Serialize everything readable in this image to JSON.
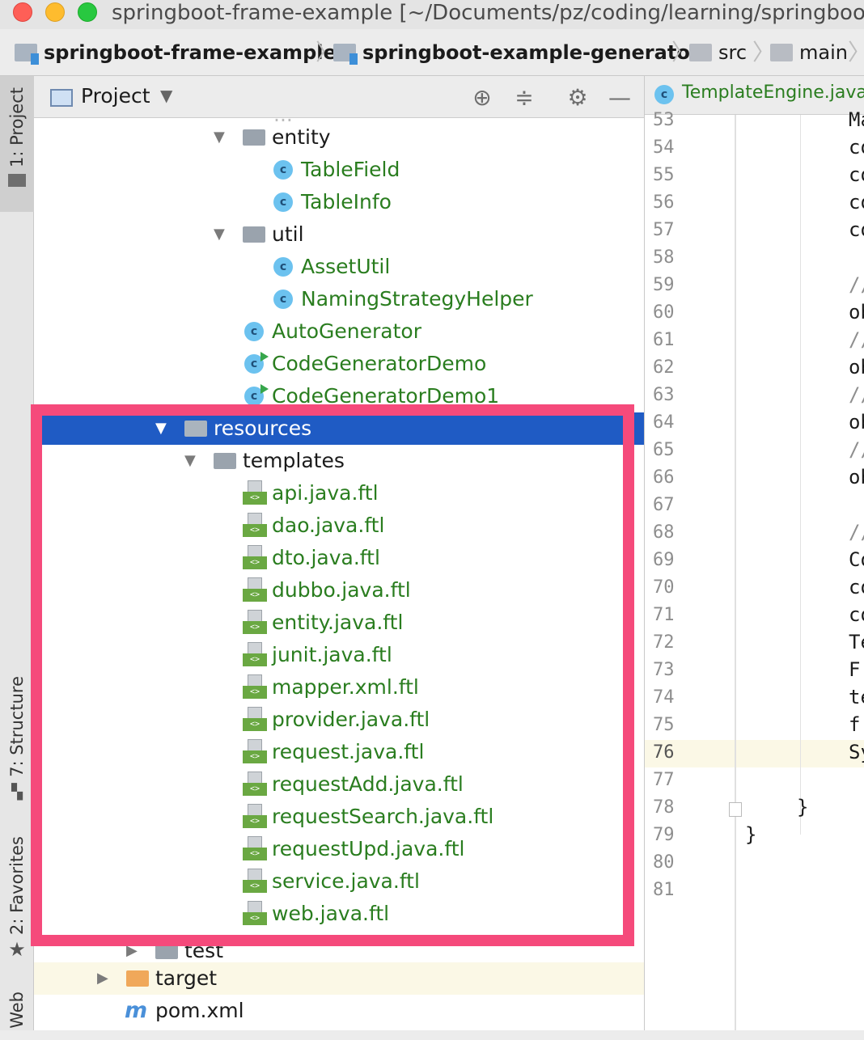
{
  "window": {
    "title": "springboot-frame-example [~/Documents/pz/coding/learning/springboot-frame-example]"
  },
  "breadcrumb": {
    "items": [
      "springboot-frame-example",
      "springboot-example-generator",
      "src",
      "main"
    ]
  },
  "side_tabs": {
    "project": "1: Project",
    "structure": "7: Structure",
    "favorites": "2: Favorites",
    "web": "Web"
  },
  "project_panel": {
    "title": "Project",
    "icons": [
      "crosshair-icon",
      "collapse-icon",
      "gear-icon",
      "minimize-icon"
    ]
  },
  "tree": {
    "top_partial": "...",
    "entity_folder": "entity",
    "entity_children": [
      "TableField",
      "TableInfo"
    ],
    "util_folder": "util",
    "util_children": [
      "AssetUtil",
      "NamingStrategyHelper"
    ],
    "classes": [
      "AutoGenerator",
      "CodeGeneratorDemo",
      "CodeGeneratorDemo1"
    ],
    "resources_folder": "resources",
    "templates_folder": "templates",
    "templates": [
      "api.java.ftl",
      "dao.java.ftl",
      "dto.java.ftl",
      "dubbo.java.ftl",
      "entity.java.ftl",
      "junit.java.ftl",
      "mapper.xml.ftl",
      "provider.java.ftl",
      "request.java.ftl",
      "requestAdd.java.ftl",
      "requestSearch.java.ftl",
      "requestUpd.java.ftl",
      "service.java.ftl",
      "web.java.ftl"
    ],
    "test_folder": "test",
    "target_folder": "target",
    "pom": "pom.xml"
  },
  "editor": {
    "tab_label": "TemplateEngine.java",
    "line_numbers": [
      "53",
      "54",
      "55",
      "56",
      "57",
      "58",
      "59",
      "60",
      "61",
      "62",
      "63",
      "64",
      "65",
      "66",
      "67",
      "68",
      "69",
      "70",
      "71",
      "72",
      "73",
      "74",
      "75",
      "76",
      "77",
      "78",
      "79",
      "80",
      "81"
    ],
    "current_line": "76",
    "code_fragments": {
      "53": "Ma",
      "54": "co",
      "55": "co",
      "56": "co",
      "57": "co",
      "59": "//",
      "60": "ob",
      "61": "//",
      "62": "ob",
      "63": "//",
      "64": "ob",
      "65": "//",
      "66": "ob",
      "68": "//",
      "69": "Co",
      "70": "co",
      "71": "co",
      "72": "Te",
      "73": "F.",
      "74": "te",
      "75": "f.",
      "76": "Sy",
      "78": "}",
      "79": "}"
    }
  },
  "colors": {
    "highlight_border": "#f54a7b",
    "selection": "#1f5bc4",
    "class_name_green": "#2a7d1f"
  }
}
